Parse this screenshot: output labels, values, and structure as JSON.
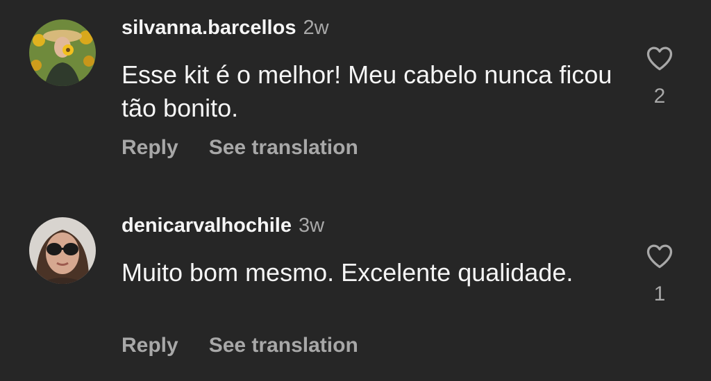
{
  "comments": [
    {
      "username": "silvanna.barcellos",
      "time": "2w",
      "text": "Esse kit é o melhor! Meu cabelo nunca ficou tão bonito.",
      "reply_label": "Reply",
      "translate_label": "See translation",
      "likes": "2",
      "like_icon": "heart-outline-icon"
    },
    {
      "username": "denicarvalhochile",
      "time": "3w",
      "text": "Muito bom mesmo. Excelente qualidade.",
      "reply_label": "Reply",
      "translate_label": "See translation",
      "likes": "1",
      "like_icon": "heart-outline-icon"
    }
  ]
}
